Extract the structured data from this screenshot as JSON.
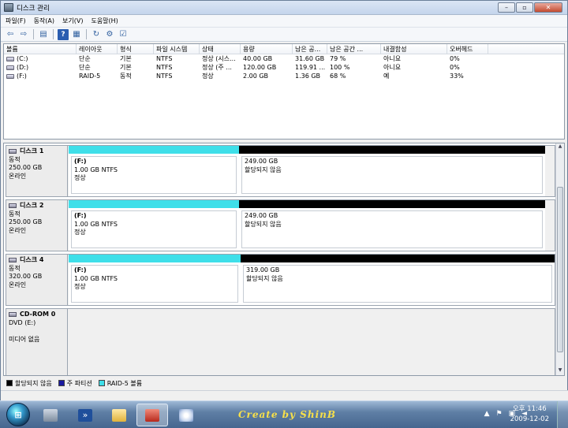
{
  "window": {
    "title": "디스크 관리"
  },
  "menu": [
    "파일(F)",
    "동작(A)",
    "보기(V)",
    "도움말(H)"
  ],
  "volume_list": {
    "columns": [
      "볼륨",
      "레이아웃",
      "형식",
      "파일 시스템",
      "상태",
      "용량",
      "남은 공...",
      "남은 공간 ...",
      "내결함성",
      "오버헤드"
    ],
    "rows": [
      [
        "(C:)",
        "단순",
        "기본",
        "NTFS",
        "정상 (시스...",
        "40.00 GB",
        "31.60 GB",
        "79 %",
        "아니요",
        "0%"
      ],
      [
        "(D:)",
        "단순",
        "기본",
        "NTFS",
        "정상 (주 ...",
        "120.00 GB",
        "119.91 ...",
        "100 %",
        "아니요",
        "0%"
      ],
      [
        "(F:)",
        "RAID-5",
        "동적",
        "NTFS",
        "정상",
        "2.00 GB",
        "1.36 GB",
        "68 %",
        "예",
        "33%"
      ]
    ]
  },
  "disks": [
    {
      "name": "디스크 1",
      "type": "동적",
      "size": "250.00 GB",
      "state": "온라인",
      "partitions": [
        {
          "kind": "raid",
          "volume": "(F:)",
          "size": "1.00 GB NTFS",
          "status": "정상"
        },
        {
          "kind": "unalloc",
          "volume": "",
          "size": "249.00 GB",
          "status": "할당되지 않음"
        }
      ]
    },
    {
      "name": "디스크 2",
      "type": "동적",
      "size": "250.00 GB",
      "state": "온라인",
      "partitions": [
        {
          "kind": "raid",
          "volume": "(F:)",
          "size": "1.00 GB NTFS",
          "status": "정상"
        },
        {
          "kind": "unalloc",
          "volume": "",
          "size": "249.00 GB",
          "status": "할당되지 않음"
        }
      ]
    },
    {
      "name": "디스크 4",
      "type": "동적",
      "size": "320.00 GB",
      "state": "온라인",
      "partitions": [
        {
          "kind": "raid",
          "volume": "(F:)",
          "size": "1.00 GB NTFS",
          "status": "정상"
        },
        {
          "kind": "unalloc",
          "volume": "",
          "size": "319.00 GB",
          "status": "할당되지 않음"
        }
      ]
    },
    {
      "name": "CD-ROM 0",
      "type": "DVD (E:)",
      "size": "",
      "state": "미디어 없음",
      "partitions": []
    }
  ],
  "legend": [
    {
      "label": "할당되지 않음",
      "color": "#000000"
    },
    {
      "label": "주 파티션",
      "color": "#1a1aa0"
    },
    {
      "label": "RAID-5 볼륨",
      "color": "#3fdfe9"
    }
  ],
  "taskbar": {
    "watermark": "Create by ShinB",
    "clock_time": "오후 11:46",
    "clock_date": "2009-12-02"
  }
}
